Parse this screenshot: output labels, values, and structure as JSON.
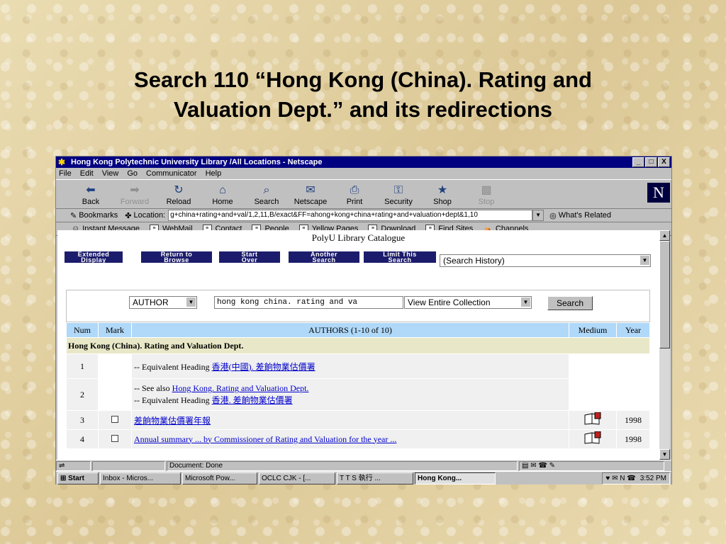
{
  "slide": {
    "title_line1": "Search 110 “Hong Kong (China). Rating and",
    "title_line2": "Valuation Dept.” and its redirections"
  },
  "window": {
    "title": "Hong Kong Polytechnic University Library /All Locations - Netscape",
    "title_buttons": [
      "_",
      "□",
      "X"
    ]
  },
  "menu": [
    "File",
    "Edit",
    "View",
    "Go",
    "Communicator",
    "Help"
  ],
  "toolbar": [
    {
      "label": "Back",
      "icon": "⬅",
      "enabled": true
    },
    {
      "label": "Forward",
      "icon": "➡",
      "enabled": false
    },
    {
      "label": "Reload",
      "icon": "↻",
      "enabled": true
    },
    {
      "label": "Home",
      "icon": "⌂",
      "enabled": true
    },
    {
      "label": "Search",
      "icon": "⌕",
      "enabled": true
    },
    {
      "label": "Netscape",
      "icon": "✉",
      "enabled": true
    },
    {
      "label": "Print",
      "icon": "⎙",
      "enabled": true
    },
    {
      "label": "Security",
      "icon": "⚿",
      "enabled": true
    },
    {
      "label": "Shop",
      "icon": "★",
      "enabled": true
    },
    {
      "label": "Stop",
      "icon": "▩",
      "enabled": false
    }
  ],
  "logo": "N",
  "location": {
    "bookmarks_label": "Bookmarks",
    "location_label": "Location:",
    "url": "g+china+rating+and+val/1,2,11,B/exact&FF=ahong+kong+china+rating+and+valuation+dept&1,10",
    "related_label": "What's Related"
  },
  "personal_bar": [
    "Instant Message",
    "WebMail",
    "Contact",
    "People",
    "Yellow Pages",
    "Download",
    "Find Sites",
    "Channels"
  ],
  "page": {
    "catalogue_title": "PolyU Library Catalogue",
    "nav_buttons": [
      {
        "line1": "Extended",
        "line2": "Display"
      },
      {
        "line1": "Return to",
        "line2": "Browse"
      },
      {
        "line1": "Start",
        "line2": "Over"
      },
      {
        "line1": "Another",
        "line2": "Search"
      },
      {
        "line1": "Limit This",
        "line2": "Search"
      }
    ],
    "history_select": "(Search History)",
    "search_type": "AUTHOR",
    "search_text": "hong kong china. rating and va",
    "collection": "View Entire Collection",
    "search_button": "Search",
    "columns": {
      "num": "Num",
      "mark": "Mark",
      "authors": "AUTHORS (1-10 of 10)",
      "medium": "Medium",
      "year": "Year"
    },
    "heading_row": "Hong Kong (China). Rating and Valuation Dept.",
    "row1": {
      "num": "1",
      "prefix": "-- Equivalent Heading ",
      "link": "香港(中國). 差餉物業估價署"
    },
    "row2": {
      "num": "2",
      "see_prefix": "-- See also ",
      "see_link": "Hong Kong. Rating and Valuation Dept.",
      "eq_prefix": "-- Equivalent Heading ",
      "eq_link": "香港. 差餉物業估價署"
    },
    "row3": {
      "num": "3",
      "title": "差餉物業估價署年報",
      "year": "1998"
    },
    "row4": {
      "num": "4",
      "title": "Annual summary ... by Commissioner of Rating and Valuation for the year ...",
      "year": "1998"
    }
  },
  "status": {
    "text": "Document: Done"
  },
  "taskbar": {
    "start": "Start",
    "items": [
      "Inbox - Micros...",
      "Microsoft Pow...",
      "OCLC CJK - [...",
      "T T S 執行 ...",
      "Hong Kong..."
    ],
    "clock": "3:52 PM"
  }
}
